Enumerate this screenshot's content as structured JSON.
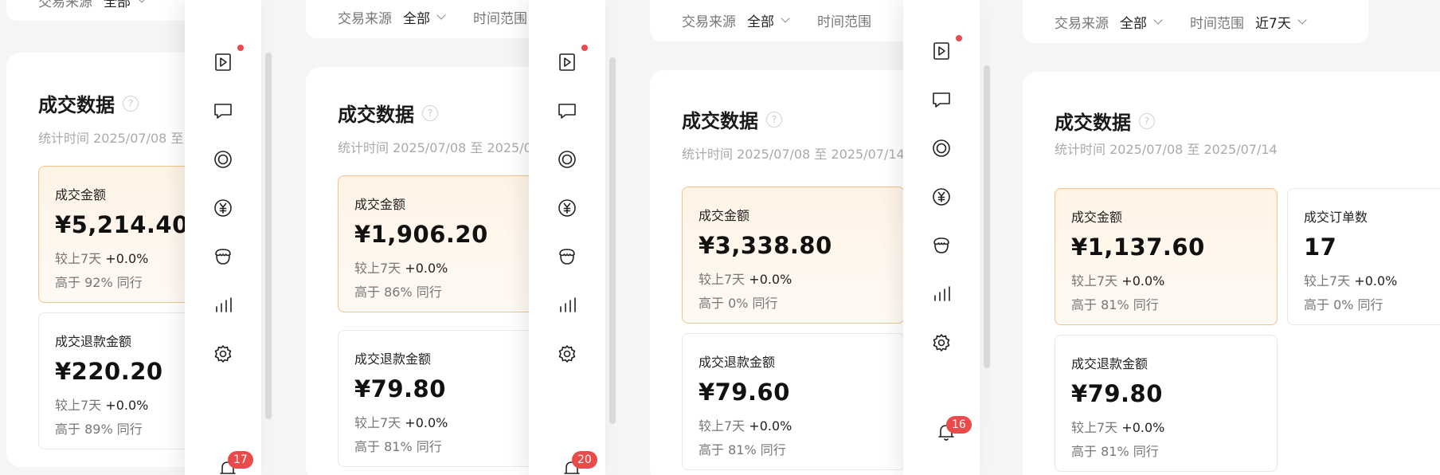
{
  "filters": {
    "source_label": "交易来源",
    "source_value": "全部",
    "range_label": "时间范围",
    "range_value": "近7天"
  },
  "card": {
    "title": "成交数据",
    "help_glyph": "?",
    "stat_time": "统计时间 2025/07/08 至 2025/07/14"
  },
  "compare_prefix": "较上7天",
  "panels": [
    {
      "amount": {
        "label": "成交金额",
        "value": "¥5,214.40",
        "change": "+0.0%",
        "peer": "高于 92% 同行"
      },
      "refund": {
        "label": "成交退款金额",
        "value": "¥220.20",
        "change": "+0.0%",
        "peer": "高于 89% 同行"
      },
      "badge": "17"
    },
    {
      "amount": {
        "label": "成交金额",
        "value": "¥1,906.20",
        "change": "+0.0%",
        "peer": "高于 86% 同行"
      },
      "refund": {
        "label": "成交退款金额",
        "value": "¥79.80",
        "change": "+0.0%",
        "peer": "高于 81% 同行"
      },
      "badge": "20"
    },
    {
      "amount": {
        "label": "成交金额",
        "value": "¥3,338.80",
        "change": "+0.0%",
        "peer": "高于 0% 同行"
      },
      "refund": {
        "label": "成交退款金额",
        "value": "¥79.60",
        "change": "+0.0%",
        "peer": "高于 81% 同行"
      },
      "badge": "16"
    },
    {
      "amount": {
        "label": "成交金额",
        "value": "¥1,137.60",
        "change": "+0.0%",
        "peer": "高于 81% 同行"
      },
      "orders": {
        "label": "成交订单数",
        "value": "17",
        "change": "+0.0%",
        "peer": "高于 0% 同行"
      },
      "refund": {
        "label": "成交退款金额",
        "value": "¥79.80",
        "change": "+0.0%",
        "peer": "高于 81% 同行"
      }
    }
  ],
  "sidebar_icons": [
    "video-play-icon",
    "chat-bubble-icon",
    "target-circle-icon",
    "yuan-coin-icon",
    "shop-awning-icon",
    "bar-chart-icon",
    "gear-icon"
  ],
  "colors": {
    "highlight_border": "#f0c48c",
    "highlight_bg": "#fff3e6",
    "badge_red": "#e94b4b"
  }
}
